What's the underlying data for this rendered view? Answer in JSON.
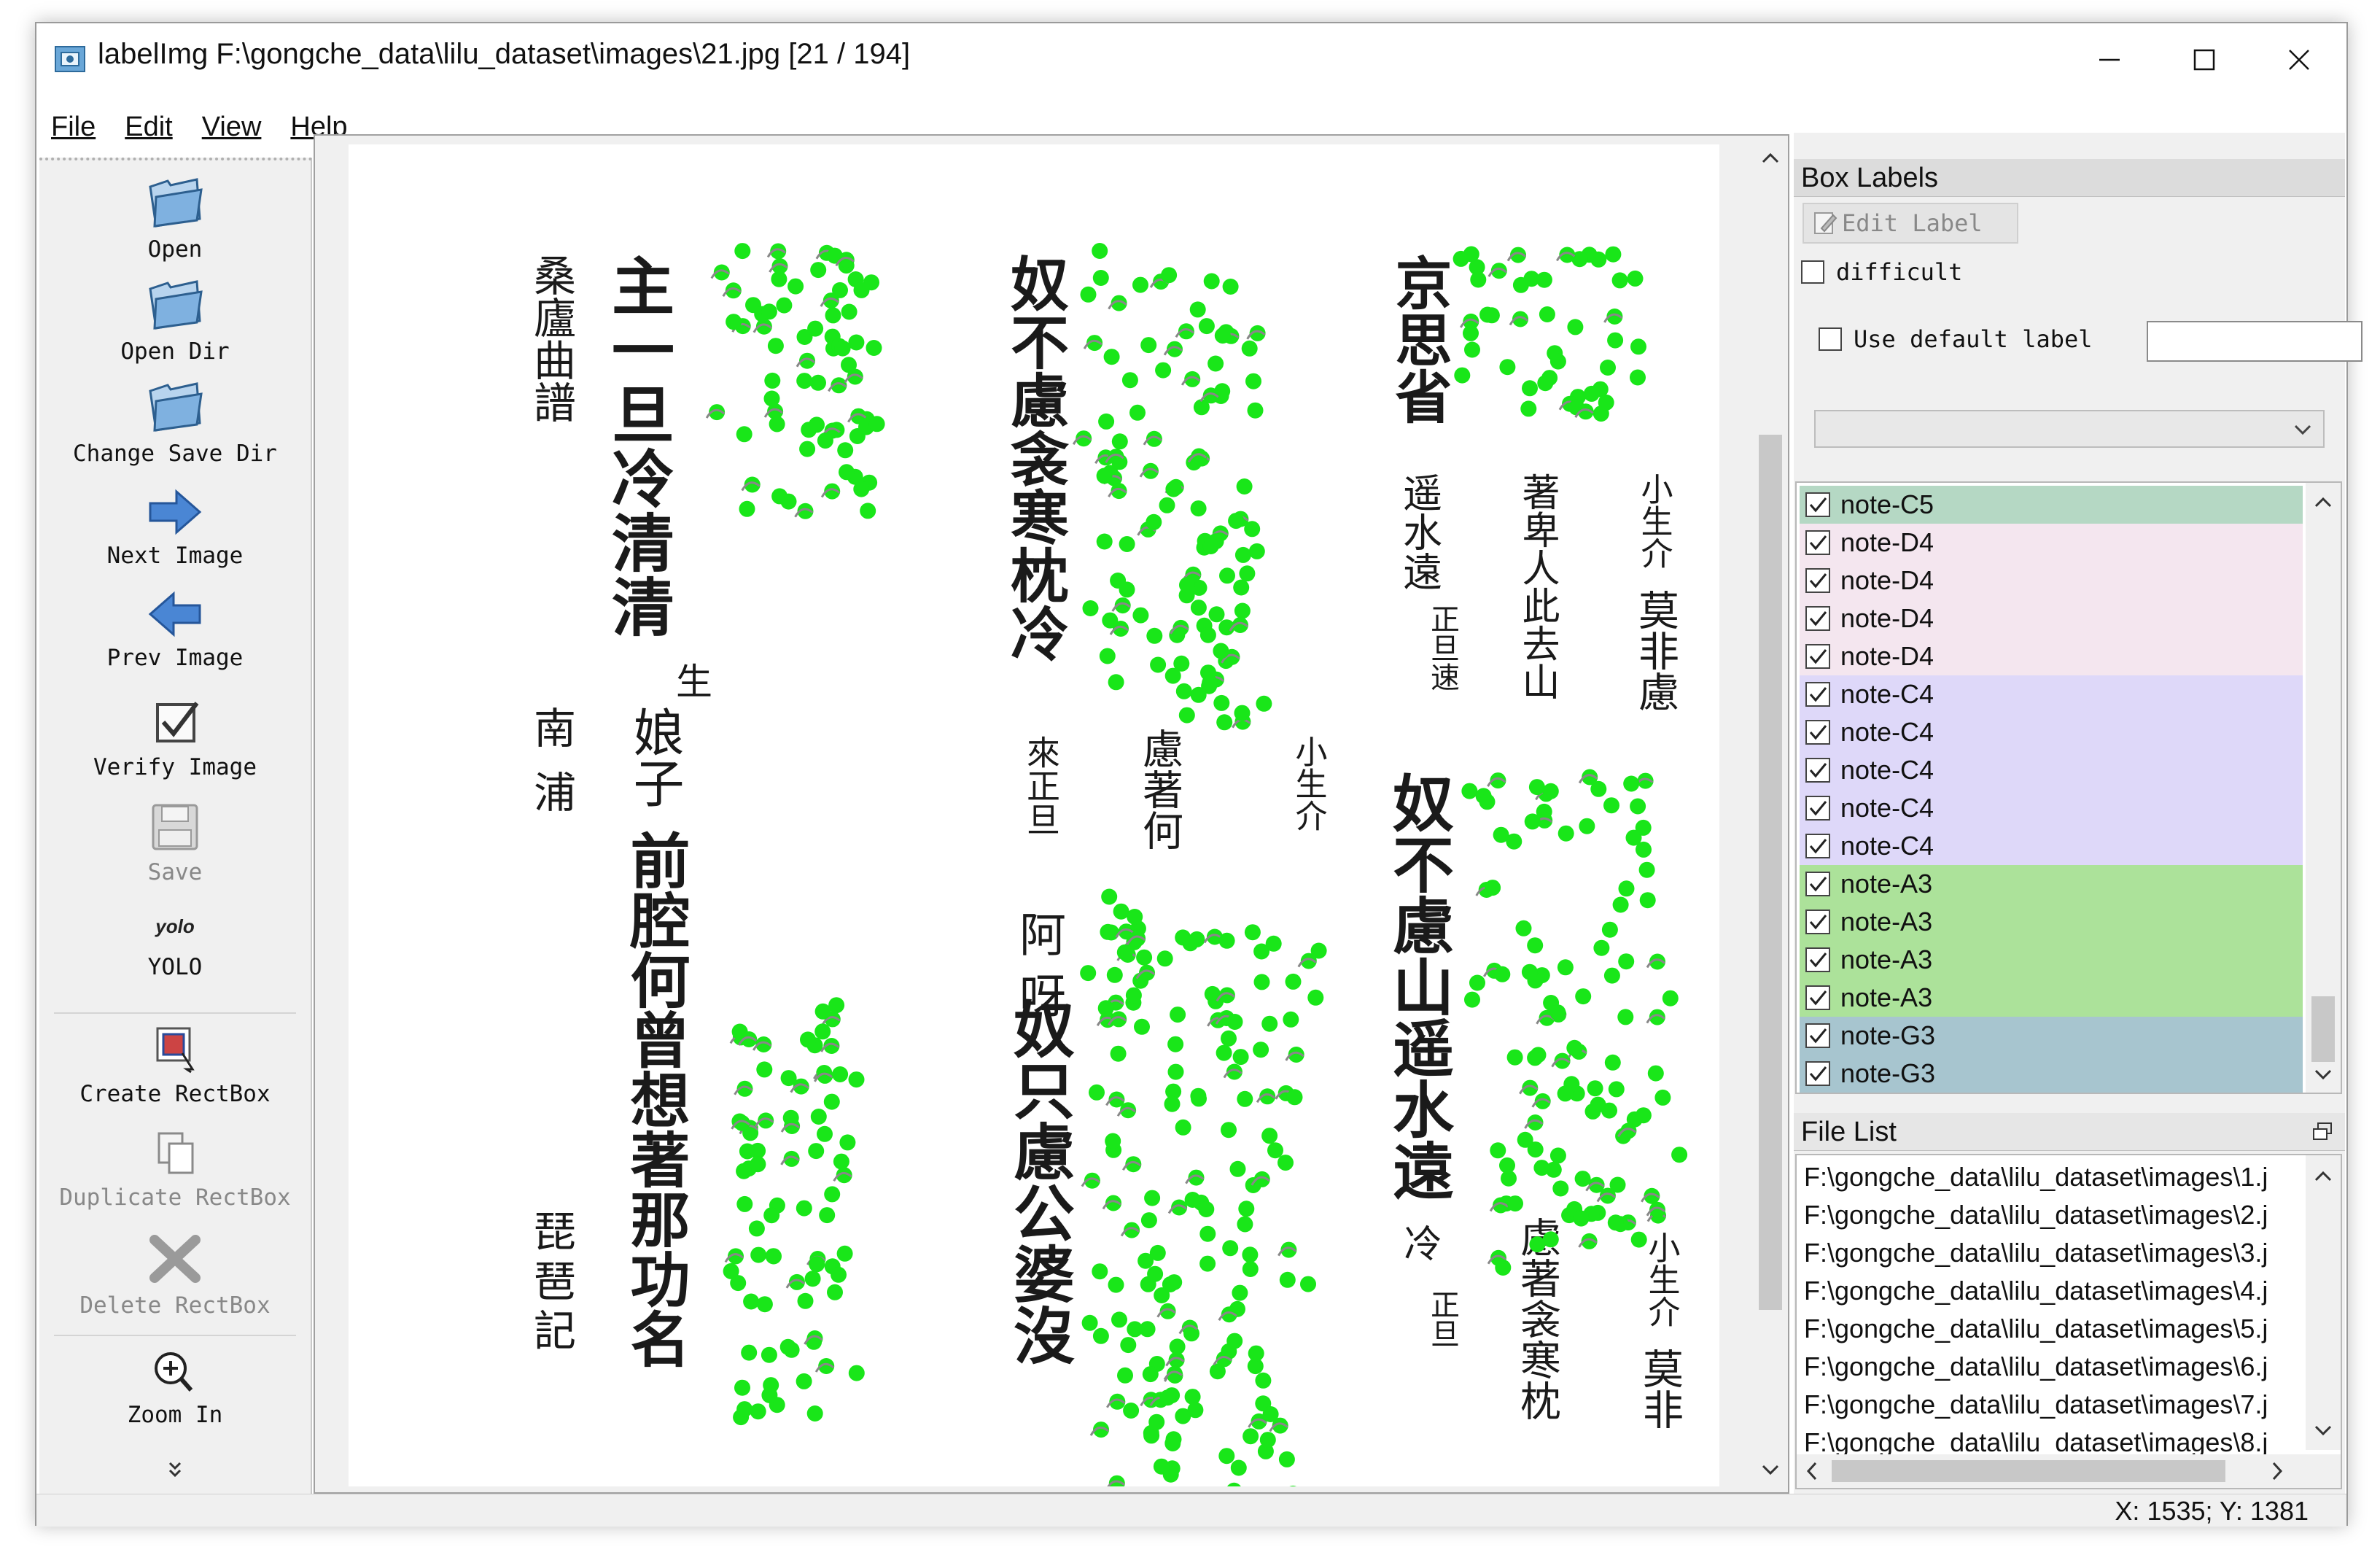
{
  "window": {
    "title": "labelImg F:\\gongche_data\\lilu_dataset\\images\\21.jpg [21 / 194]"
  },
  "menu": [
    "File",
    "Edit",
    "View",
    "Help"
  ],
  "toolbar": {
    "open": "Open",
    "open_dir": "Open Dir",
    "change_save_dir": "Change Save Dir",
    "next_image": "Next Image",
    "prev_image": "Prev Image",
    "verify_image": "Verify Image",
    "save": "Save",
    "format_icon_text": "yolo",
    "format": "YOLO",
    "create_rectbox": "Create RectBox",
    "duplicate_rectbox": "Duplicate RectBox",
    "delete_rectbox": "Delete RectBox",
    "zoom_in": "Zoom In"
  },
  "box_labels": {
    "title": "Box Labels",
    "edit_label": "Edit Label",
    "difficult": "difficult",
    "use_default_label": "Use default label",
    "default_label_value": "",
    "labels": [
      {
        "text": "note-C5",
        "color": "#b5d8c4"
      },
      {
        "text": "note-D4",
        "color": "#f4e6ef"
      },
      {
        "text": "note-D4",
        "color": "#f4e6ef"
      },
      {
        "text": "note-D4",
        "color": "#f4e6ef"
      },
      {
        "text": "note-D4",
        "color": "#f4e6ef"
      },
      {
        "text": "note-C4",
        "color": "#ded8f9"
      },
      {
        "text": "note-C4",
        "color": "#ded8f9"
      },
      {
        "text": "note-C4",
        "color": "#ded8f9"
      },
      {
        "text": "note-C4",
        "color": "#ded8f9"
      },
      {
        "text": "note-C4",
        "color": "#ded8f9"
      },
      {
        "text": "note-A3",
        "color": "#ace29a"
      },
      {
        "text": "note-A3",
        "color": "#ace29a"
      },
      {
        "text": "note-A3",
        "color": "#ace29a"
      },
      {
        "text": "note-A3",
        "color": "#ace29a"
      },
      {
        "text": "note-G3",
        "color": "#a7c5cf"
      },
      {
        "text": "note-G3",
        "color": "#a7c5cf"
      }
    ]
  },
  "file_list": {
    "title": "File List",
    "files": [
      "F:\\gongche_data\\lilu_dataset\\images\\1.j",
      "F:\\gongche_data\\lilu_dataset\\images\\2.j",
      "F:\\gongche_data\\lilu_dataset\\images\\3.j",
      "F:\\gongche_data\\lilu_dataset\\images\\4.j",
      "F:\\gongche_data\\lilu_dataset\\images\\5.j",
      "F:\\gongche_data\\lilu_dataset\\images\\6.j",
      "F:\\gongche_data\\lilu_dataset\\images\\7.j",
      "F:\\gongche_data\\lilu_dataset\\images\\8.j"
    ]
  },
  "status": "X: 1535; Y: 1381",
  "score_text": {
    "col1": "桑廬曲譜",
    "col2": "主一旦冷清清",
    "col3": "南浦",
    "col4": "生",
    "col5": "娘子",
    "col6": "前腔何曾想著那功名",
    "col7": "琵琶記",
    "col8": "奴不慮衾寒枕冷",
    "col9": "來正旦",
    "col10": "慮著何",
    "col11": "小生介",
    "col12": "阿呀",
    "col13": "奴只慮公婆沒",
    "col14": "京思省",
    "col15": "遥水遠",
    "col16": "正旦速",
    "col17": "著卑人此去山",
    "col18": "小生介",
    "col19": "莫非慮",
    "col20": "奴不慮山遥水遠",
    "col21": "冷",
    "col22": "正旦",
    "col23": "慮著衾寒枕",
    "col24": "小生介",
    "col25": "莫非"
  }
}
